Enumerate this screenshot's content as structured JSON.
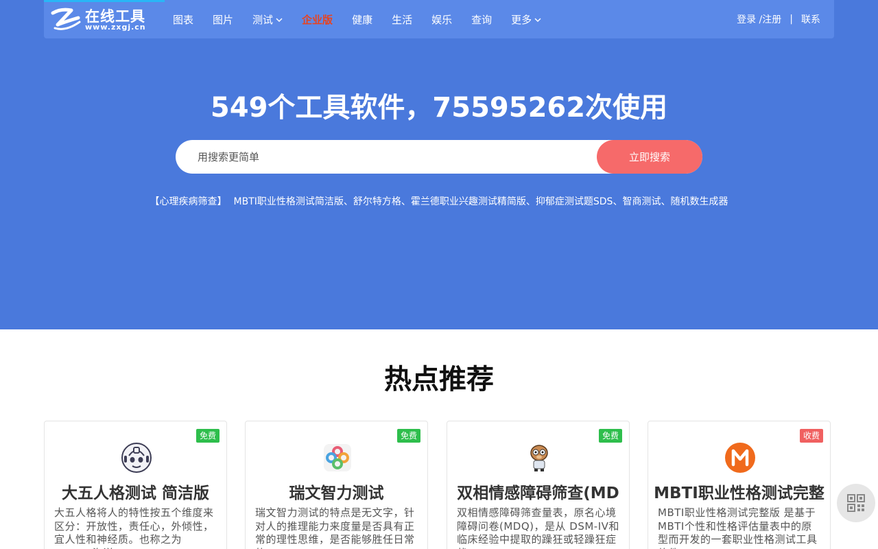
{
  "logo": {
    "title": "在线工具",
    "url": "www.zxgj.cn"
  },
  "nav": {
    "items": [
      {
        "label": "图表"
      },
      {
        "label": "图片"
      },
      {
        "label": "测试"
      },
      {
        "label": "企业版"
      },
      {
        "label": "健康"
      },
      {
        "label": "生活"
      },
      {
        "label": "娱乐"
      },
      {
        "label": "查询"
      },
      {
        "label": "更多"
      }
    ],
    "login": "登录 /注册",
    "separator": "|",
    "contact": "联系"
  },
  "hero": {
    "headline": "549个工具软件，75595262次使用",
    "search_placeholder": "用搜索更简单",
    "search_button": "立即搜索",
    "hot_category": "【心理疾病筛查】",
    "hot_links": "MBTI职业性格测试简洁版、舒尔特方格、霍兰德职业兴趣测试精简版、抑郁症测试题SDS、智商测试、随机数生成器"
  },
  "section": {
    "title": "热点推荐"
  },
  "cards": [
    {
      "badge": "免费",
      "icon": "robot-face-icon",
      "title": "大五人格测试 简洁版",
      "desc": "大五人格将人的特性按五个维度来区分：开放性，责任心，外倾性，宜人性和神经质。也称之为OCEAN海洋"
    },
    {
      "badge": "免费",
      "icon": "knot-pattern-icon",
      "title": "瑞文智力测试",
      "desc": "瑞文智力测试的特点是无文字，针对人的推理能力来度量是否具有正常的理性思维，是否能够胜任日常的"
    },
    {
      "badge": "免费",
      "icon": "cartoon-character-icon",
      "title": "双相情感障碍筛查(MD",
      "desc": "双相情感障碍筛查量表，原名心境障碍问卷(MDQ)，是从 DSM-IV和临床经验中提取的躁狂或轻躁狂症状"
    },
    {
      "badge": "收费",
      "icon": "m-letter-icon",
      "title": "MBTI职业性格测试完整",
      "desc": "MBTI职业性格测试完整版 是基于MBTI个性和性格评估量表中的原型而开发的一套职业性格测试工具软件"
    }
  ],
  "colors": {
    "hero_bg": "#4a79dc",
    "navbar_bg": "#5b89e8",
    "accent_red": "#f66a6a",
    "enterprise": "#e8431f",
    "free_badge": "#2ebe4c",
    "paid_badge": "#f06060"
  }
}
